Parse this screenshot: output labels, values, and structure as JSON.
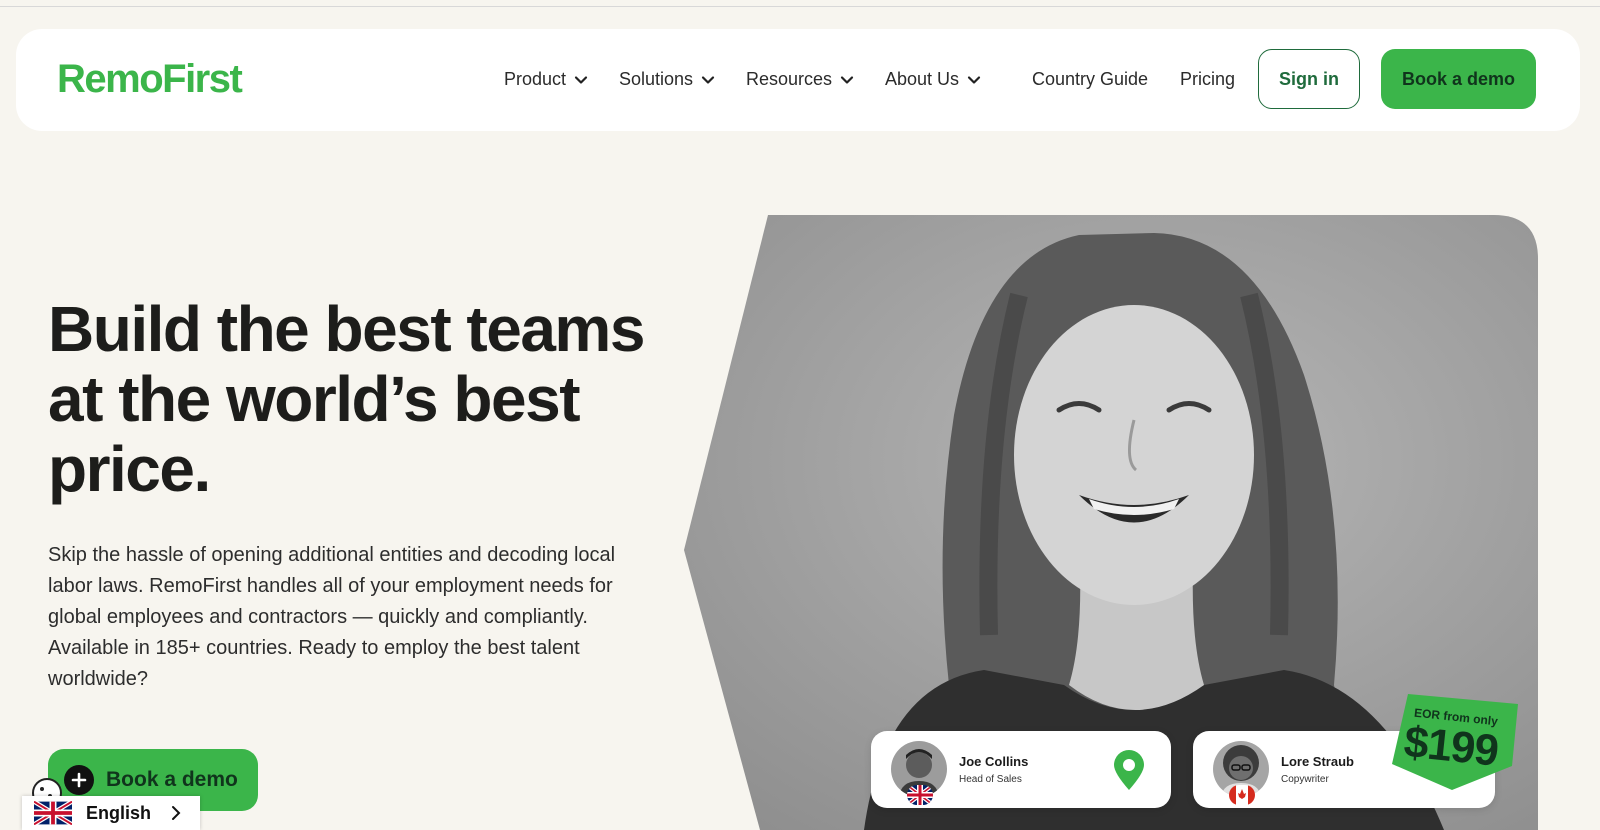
{
  "brand": {
    "logo_text": "RemoFirst",
    "accent_color": "#3bb54a",
    "dark_green": "#1f6b3c",
    "background": "#f7f5ef"
  },
  "nav": {
    "items": [
      {
        "label": "Product",
        "has_dropdown": true
      },
      {
        "label": "Solutions",
        "has_dropdown": true
      },
      {
        "label": "Resources",
        "has_dropdown": true
      },
      {
        "label": "About Us",
        "has_dropdown": true
      },
      {
        "label": "Country Guide",
        "has_dropdown": false
      },
      {
        "label": "Pricing",
        "has_dropdown": false
      }
    ],
    "sign_in_label": "Sign in",
    "book_demo_label": "Book a demo"
  },
  "hero": {
    "headline": "Build the best teams at the world’s best price.",
    "description": "Skip the hassle of opening additional entities and decoding local labor laws. RemoFirst handles all of your employment needs for global employees and contractors — quickly and compliantly. Available in 185+ countries. Ready to employ the best talent worldwide?",
    "cta_label": "Book a demo",
    "cta_icon": "plus-icon"
  },
  "people_cards": [
    {
      "name": "Joe Collins",
      "role": "Head of Sales",
      "country_flag": "uk-flag-icon",
      "location_icon": "map-pin-icon"
    },
    {
      "name": "Lore Straub",
      "role": "Copywriter",
      "country_flag": "canada-flag-icon"
    }
  ],
  "price_tag": {
    "caption": "EOR from only",
    "price": "$199"
  },
  "language_selector": {
    "label": "English",
    "flag_icon": "uk-flag-icon"
  },
  "cookie": {
    "icon": "cookie-icon"
  }
}
